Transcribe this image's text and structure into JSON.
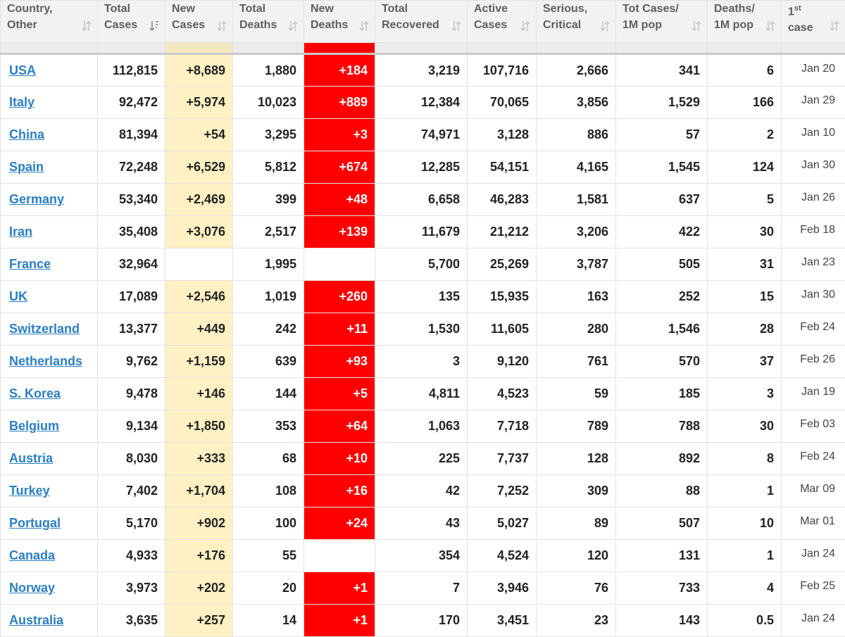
{
  "headers": [
    {
      "line1": "Country,",
      "line2": "Other"
    },
    {
      "line1": "Total",
      "line2": "Cases"
    },
    {
      "line1": "New",
      "line2": "Cases"
    },
    {
      "line1": "Total",
      "line2": "Deaths"
    },
    {
      "line1": "New",
      "line2": "Deaths"
    },
    {
      "line1": "Total",
      "line2": "Recovered"
    },
    {
      "line1": "Active",
      "line2": "Cases"
    },
    {
      "line1": "Serious,",
      "line2": "Critical"
    },
    {
      "line1": "Tot Cases/",
      "line2": "1M pop"
    },
    {
      "line1": "Deaths/",
      "line2": "1M pop"
    },
    {
      "line1": "1",
      "sup": "st",
      "line2": "case"
    }
  ],
  "colors": {
    "new_cases_bg": "#fff1c4",
    "new_deaths_bg": "#ff0000",
    "link": "#2b7ec2",
    "header_bg": "#f2f2f2"
  },
  "rows": [
    {
      "country": "USA",
      "total_cases": "112,815",
      "new_cases": "+8,689",
      "total_deaths": "1,880",
      "new_deaths": "+184",
      "total_recovered": "3,219",
      "active_cases": "107,716",
      "serious": "2,666",
      "cases_per_m": "341",
      "deaths_per_m": "6",
      "first_case": "Jan 20"
    },
    {
      "country": "Italy",
      "total_cases": "92,472",
      "new_cases": "+5,974",
      "total_deaths": "10,023",
      "new_deaths": "+889",
      "total_recovered": "12,384",
      "active_cases": "70,065",
      "serious": "3,856",
      "cases_per_m": "1,529",
      "deaths_per_m": "166",
      "first_case": "Jan 29"
    },
    {
      "country": "China",
      "total_cases": "81,394",
      "new_cases": "+54",
      "total_deaths": "3,295",
      "new_deaths": "+3",
      "total_recovered": "74,971",
      "active_cases": "3,128",
      "serious": "886",
      "cases_per_m": "57",
      "deaths_per_m": "2",
      "first_case": "Jan 10"
    },
    {
      "country": "Spain",
      "total_cases": "72,248",
      "new_cases": "+6,529",
      "total_deaths": "5,812",
      "new_deaths": "+674",
      "total_recovered": "12,285",
      "active_cases": "54,151",
      "serious": "4,165",
      "cases_per_m": "1,545",
      "deaths_per_m": "124",
      "first_case": "Jan 30"
    },
    {
      "country": "Germany",
      "total_cases": "53,340",
      "new_cases": "+2,469",
      "total_deaths": "399",
      "new_deaths": "+48",
      "total_recovered": "6,658",
      "active_cases": "46,283",
      "serious": "1,581",
      "cases_per_m": "637",
      "deaths_per_m": "5",
      "first_case": "Jan 26"
    },
    {
      "country": "Iran",
      "total_cases": "35,408",
      "new_cases": "+3,076",
      "total_deaths": "2,517",
      "new_deaths": "+139",
      "total_recovered": "11,679",
      "active_cases": "21,212",
      "serious": "3,206",
      "cases_per_m": "422",
      "deaths_per_m": "30",
      "first_case": "Feb 18"
    },
    {
      "country": "France",
      "total_cases": "32,964",
      "new_cases": "",
      "total_deaths": "1,995",
      "new_deaths": "",
      "total_recovered": "5,700",
      "active_cases": "25,269",
      "serious": "3,787",
      "cases_per_m": "505",
      "deaths_per_m": "31",
      "first_case": "Jan 23"
    },
    {
      "country": "UK",
      "total_cases": "17,089",
      "new_cases": "+2,546",
      "total_deaths": "1,019",
      "new_deaths": "+260",
      "total_recovered": "135",
      "active_cases": "15,935",
      "serious": "163",
      "cases_per_m": "252",
      "deaths_per_m": "15",
      "first_case": "Jan 30"
    },
    {
      "country": "Switzerland",
      "total_cases": "13,377",
      "new_cases": "+449",
      "total_deaths": "242",
      "new_deaths": "+11",
      "total_recovered": "1,530",
      "active_cases": "11,605",
      "serious": "280",
      "cases_per_m": "1,546",
      "deaths_per_m": "28",
      "first_case": "Feb 24"
    },
    {
      "country": "Netherlands",
      "total_cases": "9,762",
      "new_cases": "+1,159",
      "total_deaths": "639",
      "new_deaths": "+93",
      "total_recovered": "3",
      "active_cases": "9,120",
      "serious": "761",
      "cases_per_m": "570",
      "deaths_per_m": "37",
      "first_case": "Feb 26"
    },
    {
      "country": "S. Korea",
      "total_cases": "9,478",
      "new_cases": "+146",
      "total_deaths": "144",
      "new_deaths": "+5",
      "total_recovered": "4,811",
      "active_cases": "4,523",
      "serious": "59",
      "cases_per_m": "185",
      "deaths_per_m": "3",
      "first_case": "Jan 19"
    },
    {
      "country": "Belgium",
      "total_cases": "9,134",
      "new_cases": "+1,850",
      "total_deaths": "353",
      "new_deaths": "+64",
      "total_recovered": "1,063",
      "active_cases": "7,718",
      "serious": "789",
      "cases_per_m": "788",
      "deaths_per_m": "30",
      "first_case": "Feb 03"
    },
    {
      "country": "Austria",
      "total_cases": "8,030",
      "new_cases": "+333",
      "total_deaths": "68",
      "new_deaths": "+10",
      "total_recovered": "225",
      "active_cases": "7,737",
      "serious": "128",
      "cases_per_m": "892",
      "deaths_per_m": "8",
      "first_case": "Feb 24"
    },
    {
      "country": "Turkey",
      "total_cases": "7,402",
      "new_cases": "+1,704",
      "total_deaths": "108",
      "new_deaths": "+16",
      "total_recovered": "42",
      "active_cases": "7,252",
      "serious": "309",
      "cases_per_m": "88",
      "deaths_per_m": "1",
      "first_case": "Mar 09"
    },
    {
      "country": "Portugal",
      "total_cases": "5,170",
      "new_cases": "+902",
      "total_deaths": "100",
      "new_deaths": "+24",
      "total_recovered": "43",
      "active_cases": "5,027",
      "serious": "89",
      "cases_per_m": "507",
      "deaths_per_m": "10",
      "first_case": "Mar 01"
    },
    {
      "country": "Canada",
      "total_cases": "4,933",
      "new_cases": "+176",
      "total_deaths": "55",
      "new_deaths": "",
      "total_recovered": "354",
      "active_cases": "4,524",
      "serious": "120",
      "cases_per_m": "131",
      "deaths_per_m": "1",
      "first_case": "Jan 24"
    },
    {
      "country": "Norway",
      "total_cases": "3,973",
      "new_cases": "+202",
      "total_deaths": "20",
      "new_deaths": "+1",
      "total_recovered": "7",
      "active_cases": "3,946",
      "serious": "76",
      "cases_per_m": "733",
      "deaths_per_m": "4",
      "first_case": "Feb 25"
    },
    {
      "country": "Australia",
      "total_cases": "3,635",
      "new_cases": "+257",
      "total_deaths": "14",
      "new_deaths": "+1",
      "total_recovered": "170",
      "active_cases": "3,451",
      "serious": "23",
      "cases_per_m": "143",
      "deaths_per_m": "0.5",
      "first_case": "Jan 24"
    }
  ]
}
